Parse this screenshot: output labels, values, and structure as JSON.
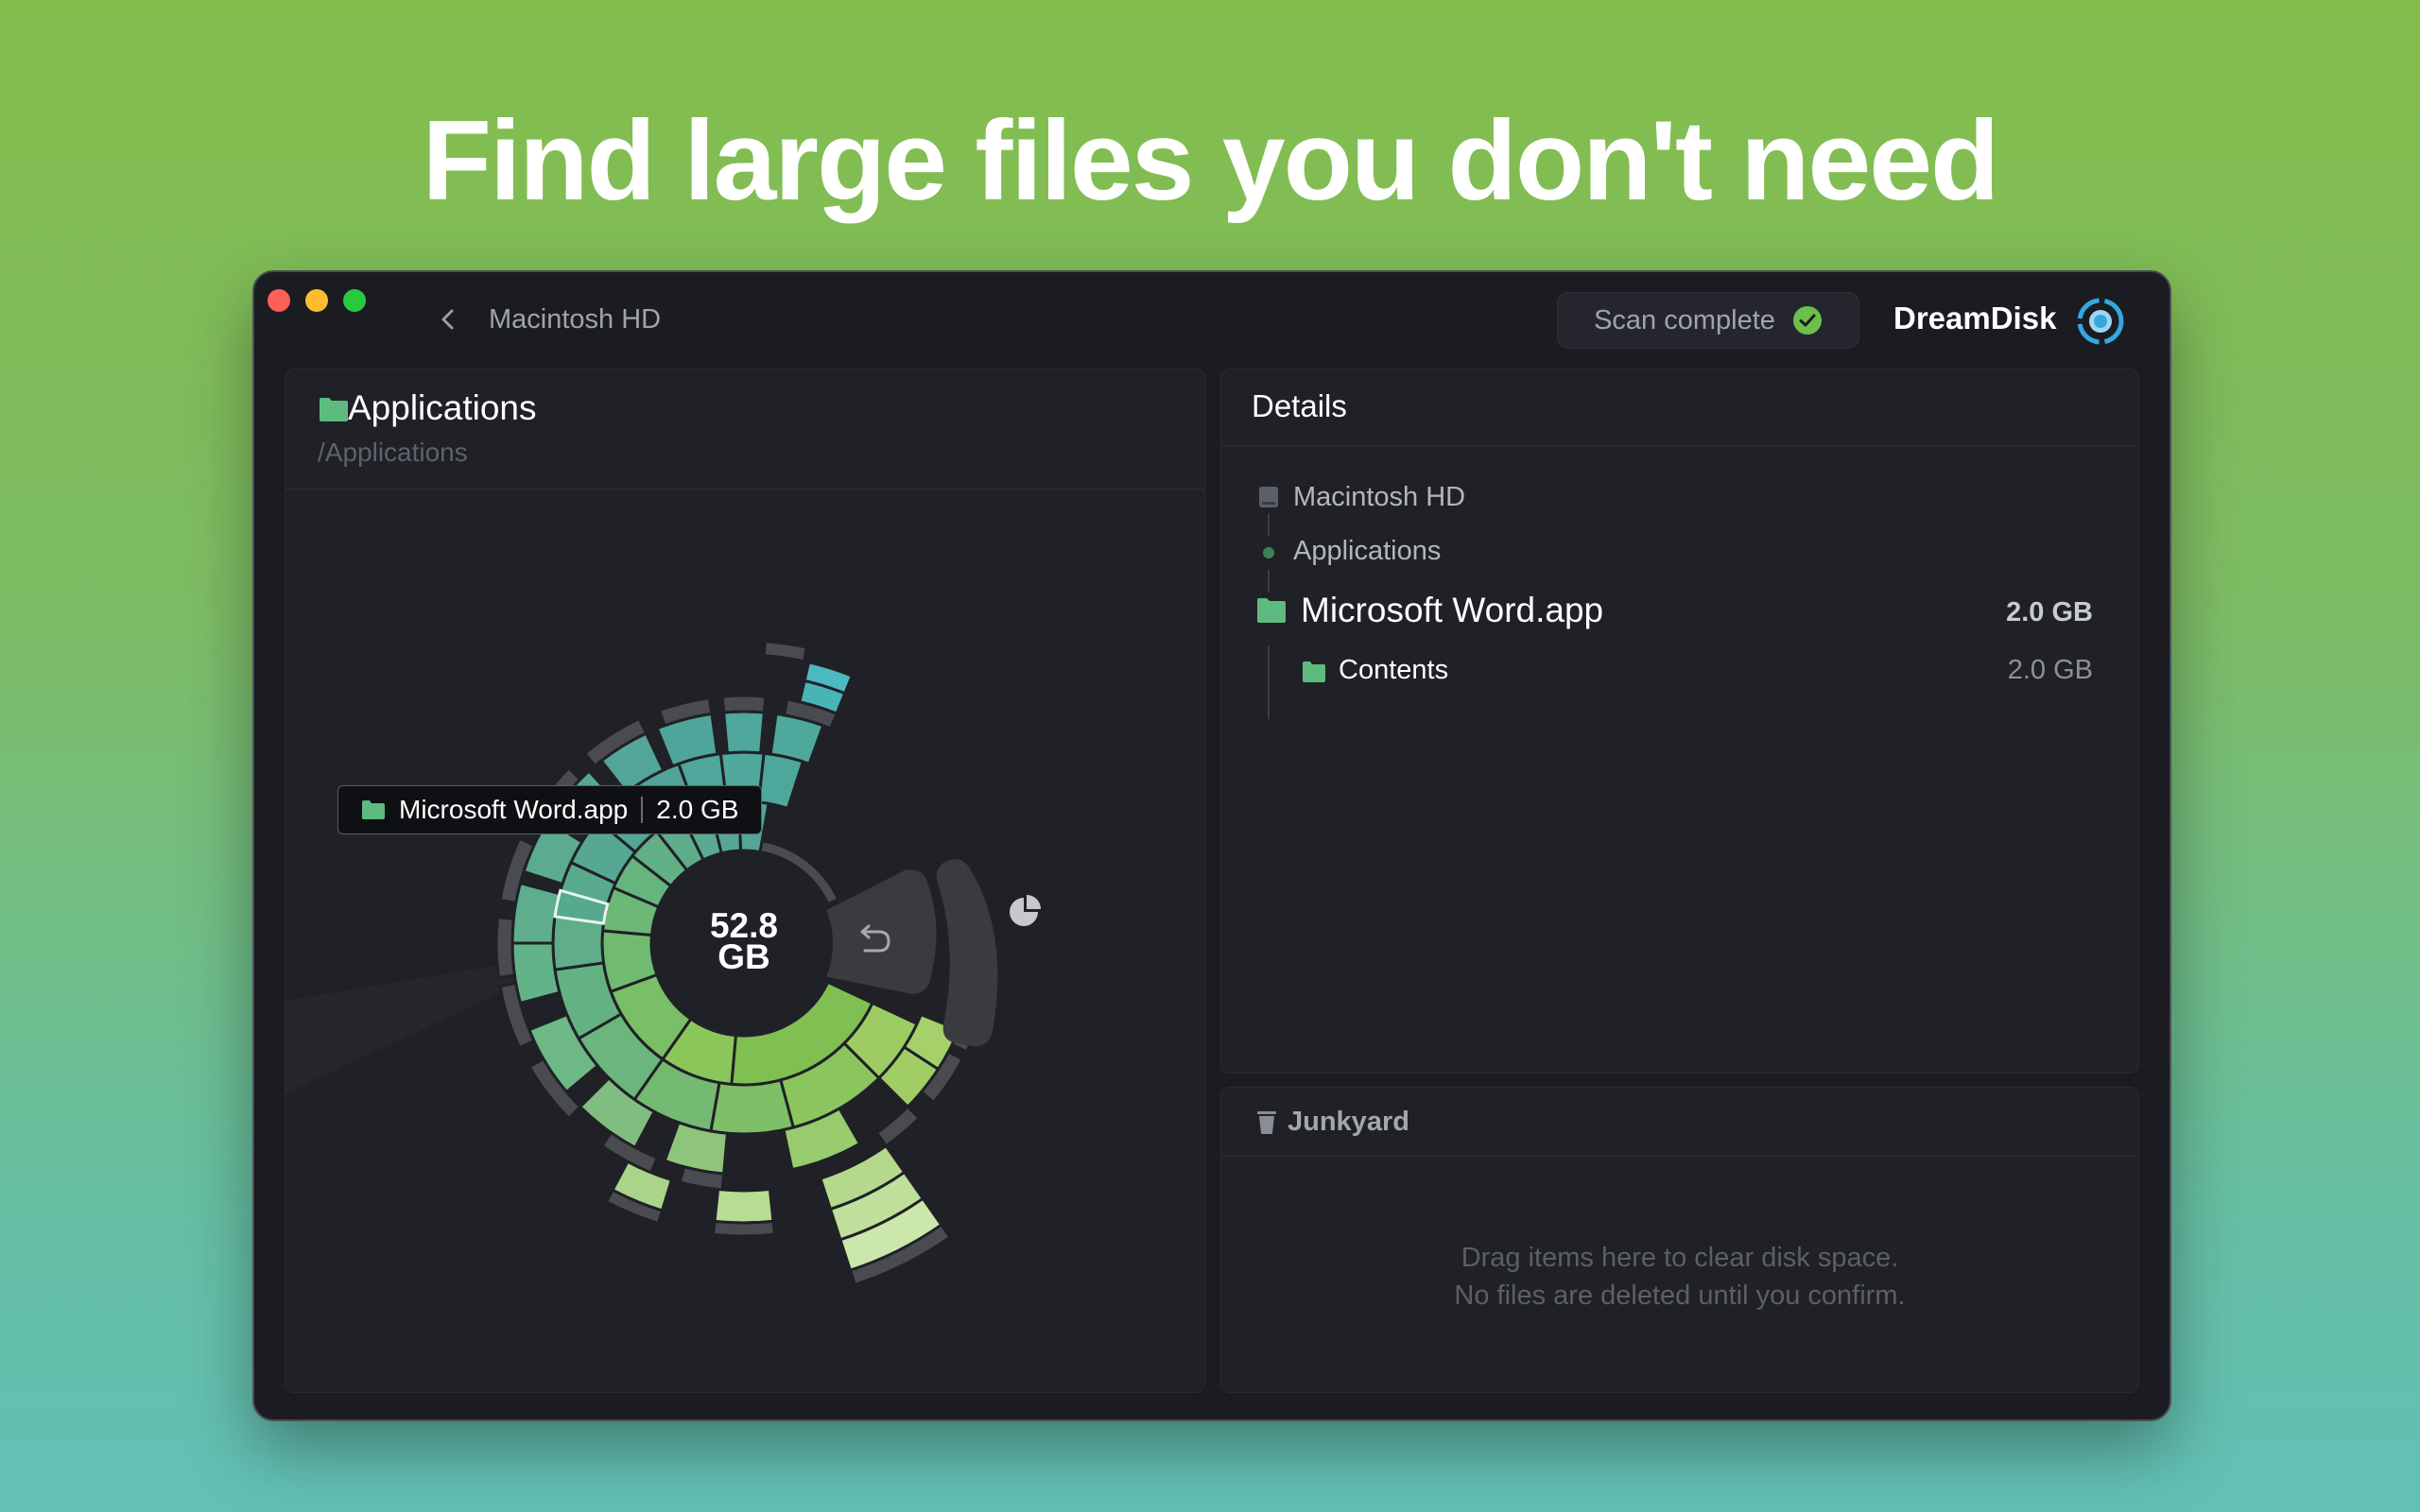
{
  "headline": "Find large files you don't need",
  "window": {
    "traffic_lights": [
      "#fe5f57",
      "#febc2e",
      "#28c840"
    ],
    "breadcrumb": "Macintosh HD",
    "scan_status": "Scan complete",
    "brand": "DreamDisk"
  },
  "left_panel": {
    "folder_name": "Applications",
    "folder_path": "/Applications",
    "total_size": [
      "52.8",
      "GB"
    ],
    "tooltip": {
      "name": "Microsoft Word.app",
      "size": "2.0 GB"
    }
  },
  "details": {
    "title": "Details",
    "path": [
      {
        "label": "Macintosh HD",
        "icon": "drive-icon"
      },
      {
        "label": "Applications",
        "icon": "dot-icon"
      }
    ],
    "selected": {
      "label": "Microsoft Word.app",
      "size": "2.0 GB"
    },
    "children": [
      {
        "label": "Contents",
        "size": "2.0 GB"
      }
    ]
  },
  "junkyard": {
    "title": "Junkyard",
    "line1": "Drag items here to clear disk space.",
    "line2": "No files are deleted until you confirm."
  },
  "colors": {
    "accent_green": "#5dbb7f",
    "check_green": "#6cbf4a",
    "brand_blue": "#36a6e0"
  }
}
